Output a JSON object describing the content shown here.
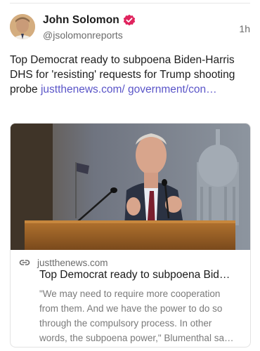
{
  "post": {
    "author_name": "John Solomon",
    "author_handle": "@jsolomonreports",
    "timestamp": "1h",
    "text": "Top Democrat ready to subpoena Biden-Harris DHS for 'resisting' requests for Trump shooting probe ",
    "link_text": "justthenews.com/ government/con…"
  },
  "link_card": {
    "domain": "justthenews.com",
    "title": "Top Democrat ready to subpoena Bid…",
    "description": "\"We may need to require more cooperation from them. And we have the power to do so through the compulsory process. In other words, the subpoena power,\" Blumenthal sa…"
  },
  "icons": {
    "verified": "verified-badge-icon",
    "link": "link-icon"
  },
  "colors": {
    "link": "#5a55c8",
    "verified": "#e0245e",
    "muted_text": "#6b6b6b"
  }
}
